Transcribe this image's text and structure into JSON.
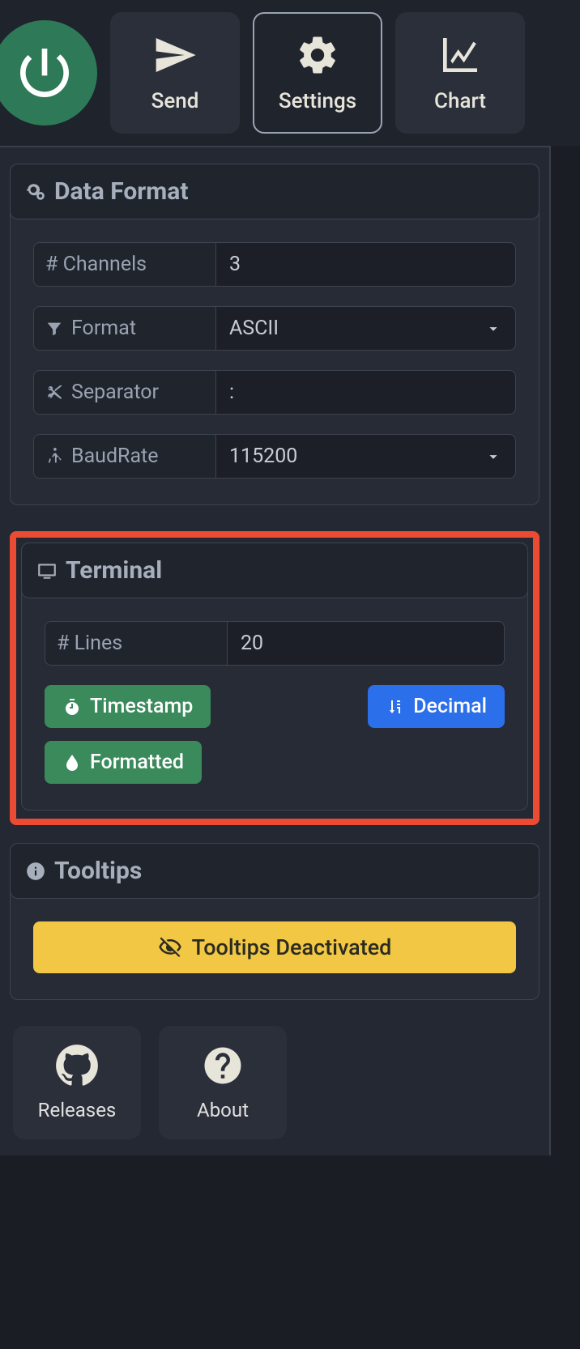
{
  "nav": {
    "send": "Send",
    "settings": "Settings",
    "chart": "Chart"
  },
  "dataFormat": {
    "title": "Data Format",
    "channels": {
      "label": "# Channels",
      "value": "3"
    },
    "format": {
      "label": "Format",
      "value": "ASCII"
    },
    "separator": {
      "label": "Separator",
      "value": ":"
    },
    "baud": {
      "label": "BaudRate",
      "value": "115200"
    }
  },
  "terminal": {
    "title": "Terminal",
    "lines": {
      "label": "# Lines",
      "value": "20"
    },
    "timestamp": "Timestamp",
    "decimal": "Decimal",
    "formatted": "Formatted"
  },
  "tooltips": {
    "title": "Tooltips",
    "button": "Tooltips Deactivated"
  },
  "footer": {
    "releases": "Releases",
    "about": "About"
  }
}
